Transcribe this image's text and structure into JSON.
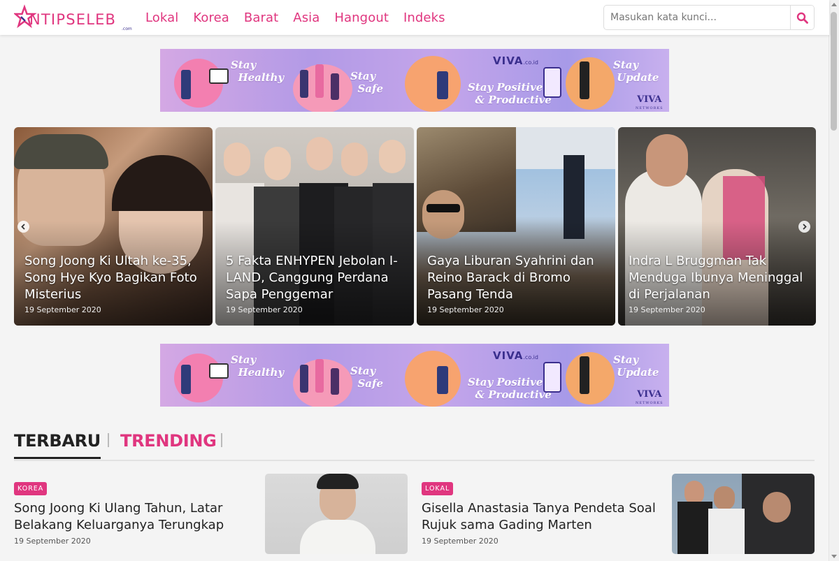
{
  "header": {
    "logo_text": "INTIPSELEB",
    "logo_suffix": ".com",
    "nav": [
      "Lokal",
      "Korea",
      "Barat",
      "Asia",
      "Hangout",
      "Indeks"
    ],
    "search_placeholder": "Masukan kata kunci..."
  },
  "ads": {
    "top": {
      "phrases": [
        "Stay\nHealthy",
        "Stay\nSafe",
        "Stay Positive\n& Productive",
        "Stay\nUpdate"
      ],
      "brand": "VIVA",
      "brand_suffix": ".co.id",
      "network": "VIVA",
      "network_sub": "NETWORKS"
    },
    "middle": {
      "phrases": [
        "Stay\nHealthy",
        "Stay\nSafe",
        "Stay Positive\n& Productive",
        "Stay\nUpdate"
      ],
      "brand": "VIVA",
      "brand_suffix": ".co.id",
      "network": "VIVA",
      "network_sub": "NETWORKS"
    }
  },
  "slider": {
    "cards": [
      {
        "title": "Song Joong Ki Ultah ke-35, Song Hye Kyo Bagikan Foto Misterius",
        "date": "19 September 2020"
      },
      {
        "title": "5 Fakta ENHYPEN Jebolan I-LAND, Canggung Perdana Sapa Penggemar",
        "date": "19 September 2020"
      },
      {
        "title": "Gaya Liburan Syahrini dan Reino Barack di Bromo Pasang Tenda",
        "date": "19 September 2020"
      },
      {
        "title": "Indra L Bruggman Tak Menduga Ibunya Meninggal di Perjalanan",
        "date": "19 September 2020"
      }
    ]
  },
  "tabs": {
    "active": "TERBARU",
    "inactive": "TRENDING"
  },
  "articles": [
    {
      "category": "KOREA",
      "title": "Song Joong Ki Ulang Tahun, Latar Belakang Keluarganya Terungkap",
      "date": "19 September 2020"
    },
    {
      "category": "LOKAL",
      "title": "Gisella Anastasia Tanya Pendeta Soal Rujuk sama Gading Marten",
      "date": "19 September 2020"
    }
  ],
  "colors": {
    "accent": "#e0367f",
    "text": "#222222",
    "background": "#f4f4f4"
  }
}
